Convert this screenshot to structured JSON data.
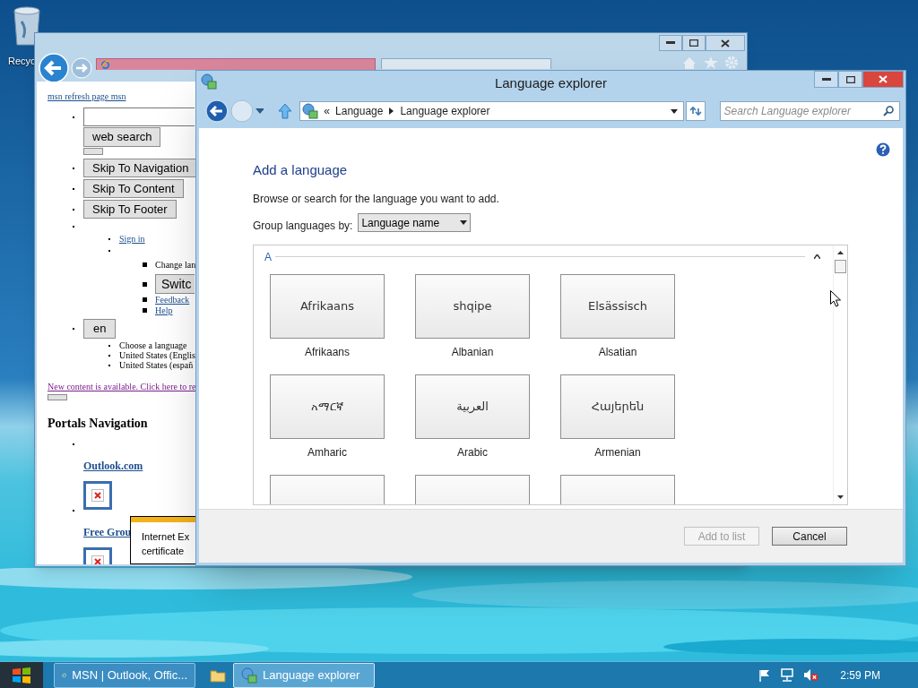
{
  "desktop": {
    "icons": [
      {
        "label": "Recyc"
      }
    ]
  },
  "browser_window": {
    "page": {
      "top_link": "msn refresh page msn",
      "search_button": "web search",
      "skip_buttons": [
        "Skip To Navigation",
        "Skip To Content",
        "Skip To Footer"
      ],
      "sign_in": "Sign in",
      "change_language": "Change lan",
      "switch_button": "Switc",
      "links": [
        "Feedback",
        "Help"
      ],
      "language_button": "en",
      "language_options": [
        "Choose a language",
        "United States (Englis",
        "United States (españ"
      ],
      "notice": "New content is available. Click here to re",
      "heading": "Portals Navigation",
      "portal_links": [
        "Outlook.com",
        "Free Grou"
      ],
      "popup": [
        "Internet Ex",
        "certificate"
      ]
    }
  },
  "language_explorer": {
    "title": "Language explorer",
    "breadcrumb_overflow": "«",
    "breadcrumb": [
      "Language",
      "Language explorer"
    ],
    "search": {
      "placeholder": "Search Language explorer"
    },
    "heading": "Add a language",
    "instruction": "Browse or search for the language you want to add.",
    "group_by": {
      "label": "Group languages by:",
      "value": "Language name"
    },
    "groups": [
      {
        "letter": "A",
        "languages": [
          {
            "native": "Afrikaans",
            "name": "Afrikaans"
          },
          {
            "native": "shqipe",
            "name": "Albanian"
          },
          {
            "native": "Elsässisch",
            "name": "Alsatian"
          },
          {
            "native": "አማርኛ",
            "name": "Amharic"
          },
          {
            "native": "العربية",
            "name": "Arabic"
          },
          {
            "native": "Հայերեն",
            "name": "Armenian"
          }
        ]
      }
    ],
    "buttons": [
      {
        "label": "Add to list",
        "disabled": true
      },
      {
        "label": "Cancel",
        "disabled": false
      }
    ]
  },
  "taskbar": {
    "buttons": [
      {
        "label": "MSN | Outlook, Offic...",
        "kind": "browser",
        "selected": false
      },
      {
        "label": "Language explorer",
        "kind": "explorer",
        "selected": true
      }
    ],
    "clock": "2:59 PM"
  }
}
